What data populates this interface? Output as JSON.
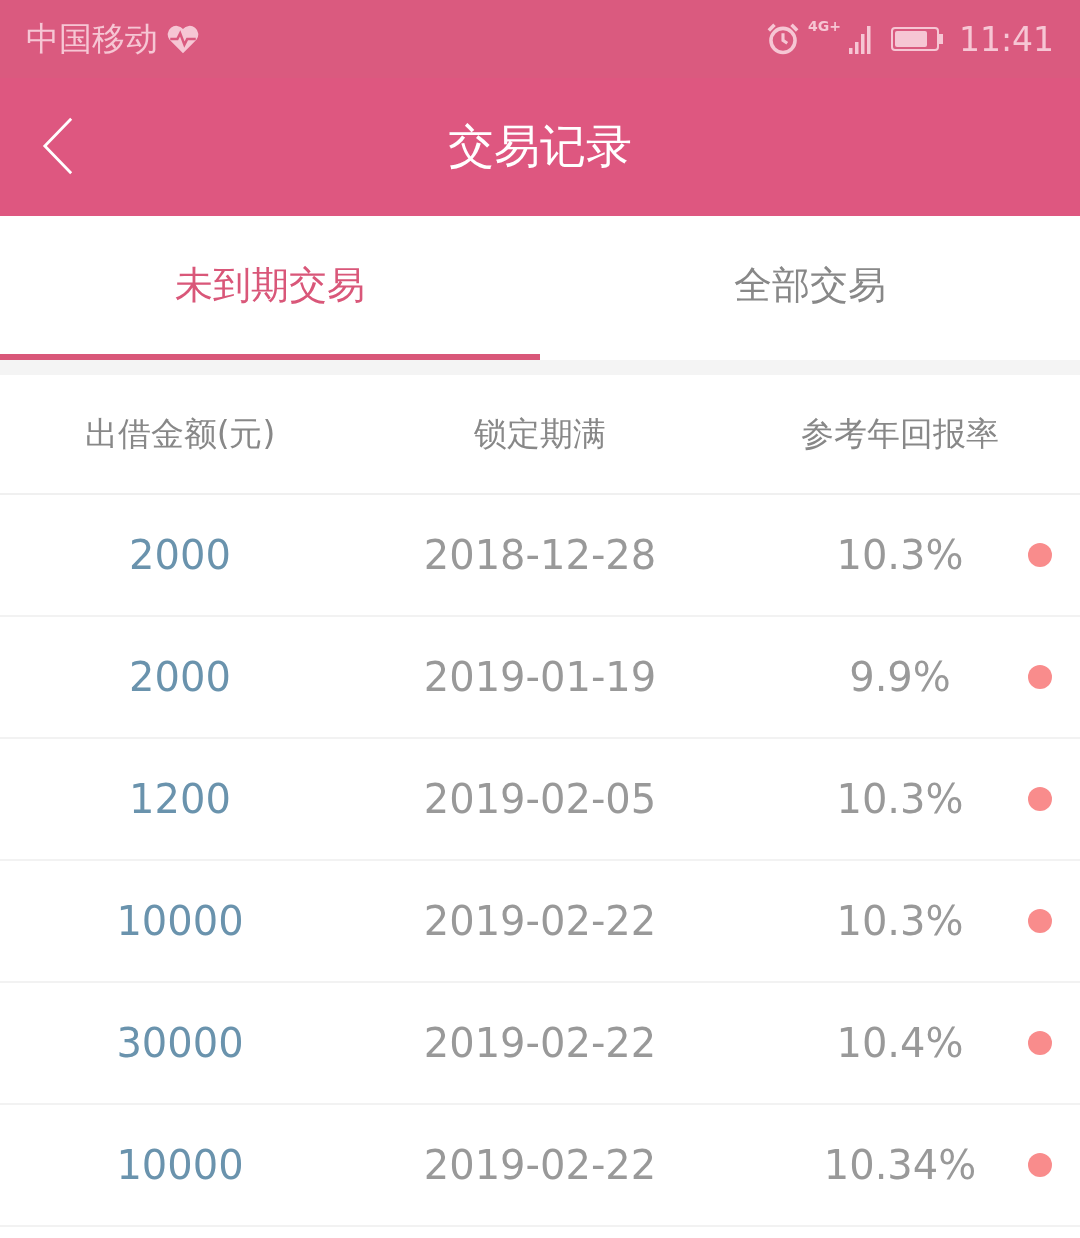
{
  "status_bar": {
    "carrier": "中国移动",
    "network": "4G+",
    "time": "11:41"
  },
  "header": {
    "title": "交易记录"
  },
  "tabs": [
    {
      "label": "未到期交易",
      "selected": true
    },
    {
      "label": "全部交易",
      "selected": false
    }
  ],
  "table": {
    "columns": [
      "出借金额(元)",
      "锁定期满",
      "参考年回报率"
    ],
    "rows": [
      {
        "amount": "2000",
        "date": "2018-12-28",
        "rate": "10.3%",
        "color": "#f98c8c"
      },
      {
        "amount": "2000",
        "date": "2019-01-19",
        "rate": "9.9%",
        "color": "#f98c8c"
      },
      {
        "amount": "1200",
        "date": "2019-02-05",
        "rate": "10.3%",
        "color": "#f98c8c"
      },
      {
        "amount": "10000",
        "date": "2019-02-22",
        "rate": "10.3%",
        "color": "#f98c8c"
      },
      {
        "amount": "30000",
        "date": "2019-02-22",
        "rate": "10.4%",
        "color": "#f98c8c"
      },
      {
        "amount": "10000",
        "date": "2019-02-22",
        "rate": "10.34%",
        "color": "#f98c8c"
      }
    ]
  }
}
